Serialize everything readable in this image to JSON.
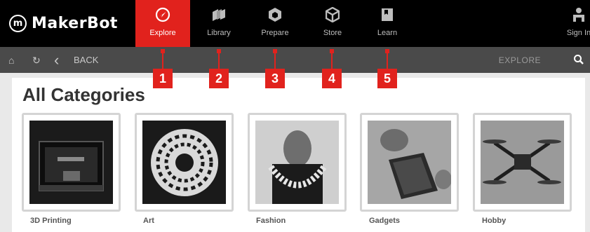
{
  "app": {
    "logo_mark": "m",
    "logo_text": "MakerBot"
  },
  "nav": {
    "items": [
      {
        "label": "Explore",
        "icon": "compass-icon"
      },
      {
        "label": "Library",
        "icon": "library-icon"
      },
      {
        "label": "Prepare",
        "icon": "prepare-icon"
      },
      {
        "label": "Store",
        "icon": "store-icon"
      },
      {
        "label": "Learn",
        "icon": "learn-icon"
      }
    ],
    "sign_in": "Sign In"
  },
  "subbar": {
    "home_icon": "⌂",
    "refresh_icon": "↻",
    "back_icon": "‹",
    "back_label": "BACK",
    "section": "EXPLORE",
    "search_icon": "search-icon"
  },
  "callouts": [
    "1",
    "2",
    "3",
    "4",
    "5"
  ],
  "page": {
    "title": "All Categories"
  },
  "categories": [
    {
      "label": "3D Printing"
    },
    {
      "label": "Art"
    },
    {
      "label": "Fashion"
    },
    {
      "label": "Gadgets"
    },
    {
      "label": "Hobby"
    }
  ],
  "colors": {
    "accent": "#e1221d",
    "topbar": "#000000",
    "subbar": "#4a4a4a"
  }
}
